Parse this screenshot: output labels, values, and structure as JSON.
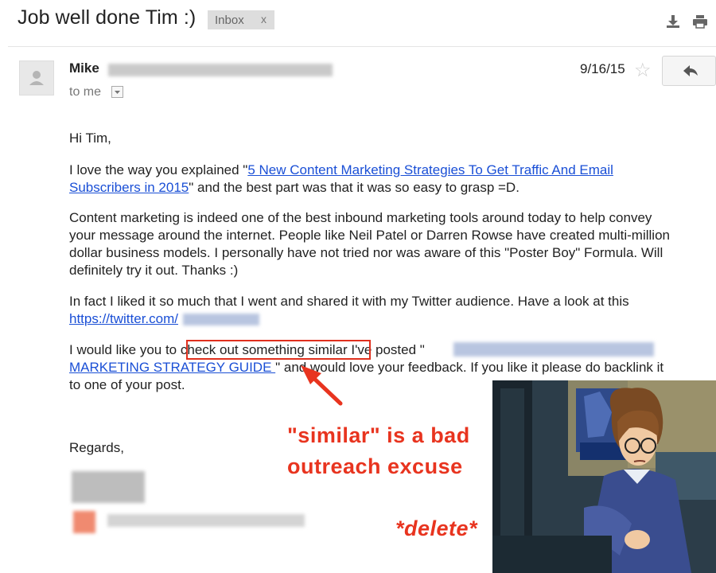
{
  "email": {
    "subject": "Job well done Tim :)",
    "label_chip": "Inbox",
    "label_close": "x",
    "sender_name": "Mike",
    "recipient": "to me",
    "date": "9/16/15"
  },
  "message": {
    "greeting": "Hi Tim,",
    "p1_a": "I love the way you explained \"",
    "p1_link_1": "5 New Content Marketing Strategies To Get Traffic And Email",
    "p1_link_2": "Subscribers in 2015",
    "p1_b": "\" and the best part was that it was so easy to grasp =D.",
    "p2_lines": [
      "Content marketing is indeed one of the best inbound marketing tools around today to help convey",
      "your message around the internet. People like Neil Patel or Darren Rowse have created multi-million",
      "dollar business models. I personally have not tried nor was aware of this \"Poster Boy\" Formula. Will",
      "definitely try it out. Thanks :)"
    ],
    "p3_line1": "In fact I liked it so much that I went and shared it with my Twitter audience. Have a look at this",
    "p3_link": "https://twitter.com/",
    "p4_a": "I would like you to ",
    "p4_highlight": "check out something similar",
    "p4_b": " I've posted \"",
    "p4_link_2": "MARKETING STRATEGY GUIDE ",
    "p4_c": "\" and would love your feedback. If you like it please do backlink it",
    "p4_d": "to one of your post.",
    "sign_off": "Regards,"
  },
  "annotations": {
    "line1": "\"similar\" is a bad",
    "line2": "outreach excuse",
    "delete": "*delete*",
    "color": "#e8341f"
  },
  "icons": {
    "download": "download-icon",
    "print": "print-icon",
    "reply": "reply-icon",
    "star": "star-icon",
    "avatar": "person-icon",
    "dropdown": "chevron-down-icon"
  }
}
